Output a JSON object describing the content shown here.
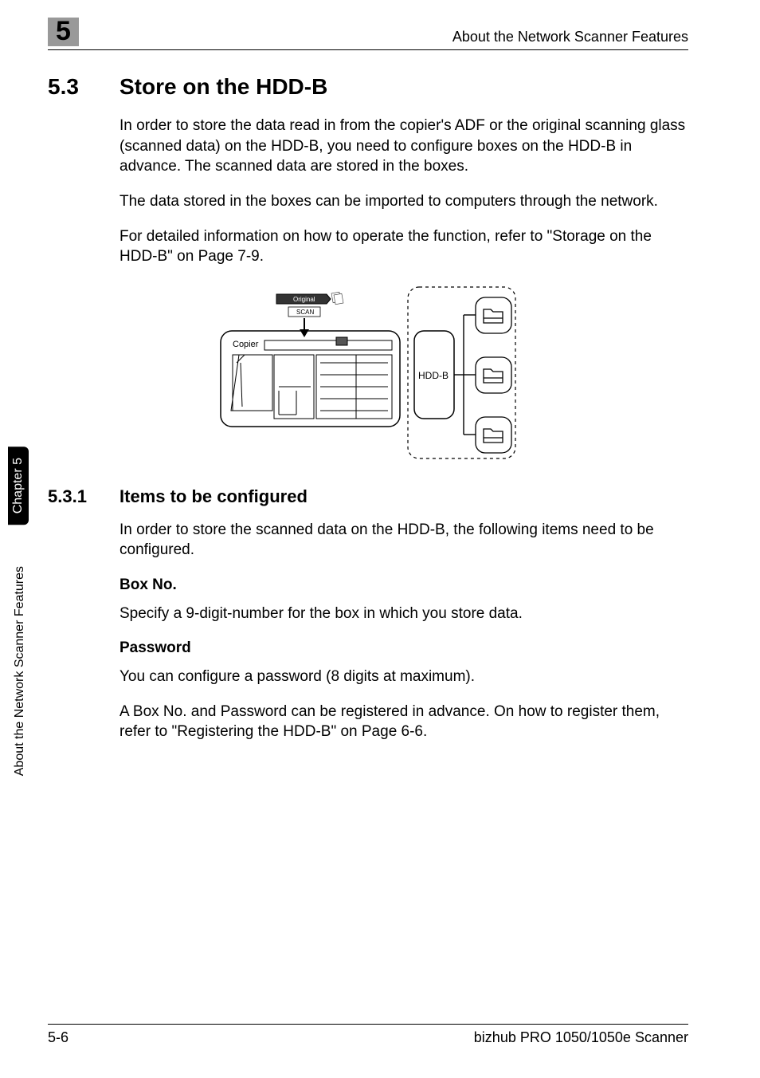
{
  "header": {
    "chapter_num": "5",
    "running_title": "About the Network Scanner Features"
  },
  "section": {
    "num": "5.3",
    "title": "Store on the HDD-B"
  },
  "paragraphs": {
    "p1": "In order to store the data read in from the copier's ADF or the original scanning glass (scanned data) on the HDD-B, you need to configure boxes on the HDD-B in advance. The scanned data are stored in the boxes.",
    "p2": "The data stored in the boxes can be imported to computers through the network.",
    "p3": "For detailed information on how to operate the function, refer to \"Storage on the HDD-B\" on Page 7-9."
  },
  "diagram": {
    "label_original": "Original",
    "label_scan": "SCAN",
    "label_copier": "Copier",
    "label_hddb": "HDD-B"
  },
  "subsection": {
    "num": "5.3.1",
    "title": "Items to be configured",
    "intro": "In order to store the scanned data on the HDD-B, the following items need to be configured."
  },
  "items": {
    "box_no_head": "Box No.",
    "box_no_text": "Specify a 9-digit-number for the box in which you store data.",
    "password_head": "Password",
    "password_text": "You can configure a password (8 digits at maximum).",
    "register_text": "A Box No. and Password can be registered in advance. On how to register them, refer to \"Registering the HDD-B\" on Page 6-6."
  },
  "side": {
    "tab": "Chapter 5",
    "label": "About the Network Scanner Features"
  },
  "footer": {
    "page": "5-6",
    "product": "bizhub PRO 1050/1050e Scanner"
  }
}
